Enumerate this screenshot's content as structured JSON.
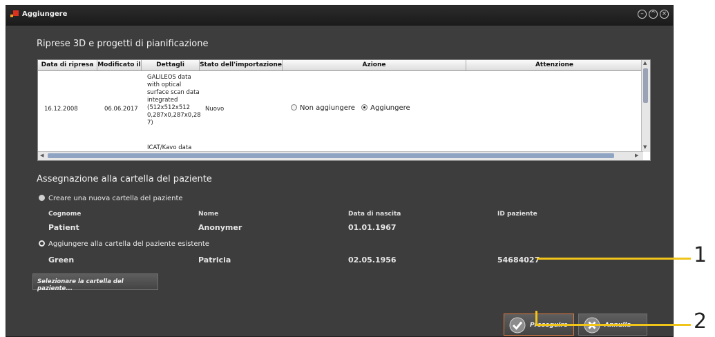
{
  "window": {
    "title": "Aggiungere"
  },
  "section_scans": {
    "title": "Riprese 3D e progetti di pianificazione"
  },
  "table": {
    "headers": [
      "Data di ripresa",
      "Modificato il",
      "Dettagli",
      "Stato dell'importazione",
      "Azione",
      "Attenzione"
    ],
    "row": {
      "date": "16.12.2008",
      "modified": "06.06.2017",
      "details_lines": [
        "GALILEOS data",
        "with optical",
        "surface scan data",
        "integrated",
        "(512x512x512",
        "0,287x0,287x0,28",
        "7)"
      ],
      "details_extra": "ICAT/Kavo data",
      "status": "Nuovo",
      "action_options": [
        "Non aggiungere",
        "Aggiungere"
      ],
      "action_selected": "Aggiungere"
    }
  },
  "section_assign": {
    "title": "Assegnazione alla cartella del paziente"
  },
  "assign": {
    "new_option": "Creare una nuova cartella del paziente",
    "existing_option": "Aggiungere alla cartella del paziente esistente",
    "selected": "existing",
    "columns": [
      "Cognome",
      "Nome",
      "Data di nascita",
      "ID paziente"
    ],
    "new_patient": {
      "surname": "Patient",
      "name": "Anonymer",
      "birth": "01.01.1967",
      "id": ""
    },
    "existing_patient": {
      "surname": "Green",
      "name": "Patricia",
      "birth": "02.05.1956",
      "id": "54684027"
    },
    "select_button": "Selezionare la cartella del paziente..."
  },
  "buttons": {
    "proceed": "Proseguire",
    "cancel": "Annulla"
  },
  "callouts": [
    "1",
    "2"
  ],
  "colors": {
    "window_bg": "#3d3d3d",
    "callout": "#f0c419",
    "accent_icon": "#8a8a8a"
  }
}
